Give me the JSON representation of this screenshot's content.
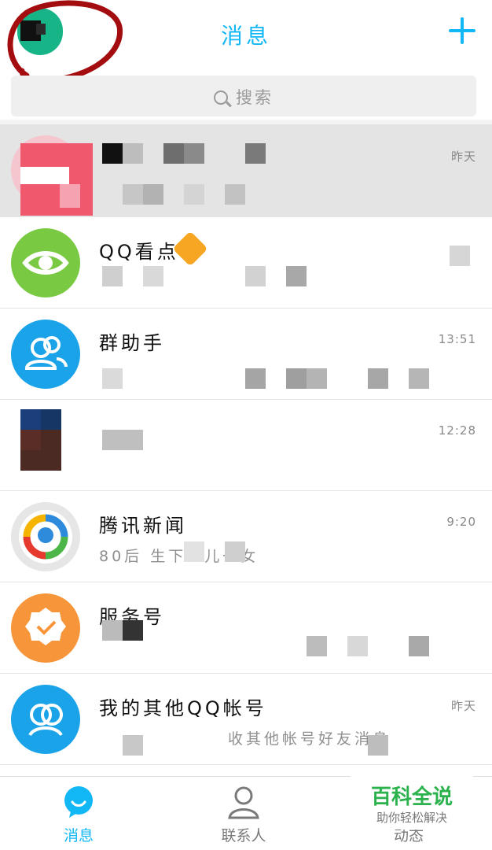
{
  "header": {
    "title": "消息",
    "plus_icon": "plus-icon",
    "accent": "#12b7f5"
  },
  "search": {
    "placeholder": "搜索",
    "icon": "search-icon"
  },
  "conversations": [
    {
      "name": "",
      "preview": "",
      "time": "昨天",
      "pinned": true
    },
    {
      "name": "QQ看点",
      "preview": "",
      "time": "",
      "icon": "eye-icon",
      "color": "#7ac943"
    },
    {
      "name": "群助手",
      "preview": "",
      "time": "13:51",
      "icon": "group-icon",
      "color": "#1aa3e8"
    },
    {
      "name": "",
      "preview": "",
      "time": "12:28"
    },
    {
      "name": "腾讯新闻",
      "preview": "80后  生下一儿一女",
      "time": "9:20",
      "icon": "tencent-news-icon"
    },
    {
      "name": "服务号",
      "preview": "",
      "time": "",
      "icon": "service-badge-icon",
      "color": "#f7953a"
    },
    {
      "name": "我的其他QQ帐号",
      "preview": "收其他帐号好友消息",
      "time": "昨天",
      "icon": "accounts-icon",
      "color": "#1aa3e8"
    }
  ],
  "tabbar": {
    "tabs": [
      {
        "label": "消息",
        "icon": "chat-bubble-icon",
        "active": true
      },
      {
        "label": "联系人",
        "icon": "contacts-icon",
        "active": false
      },
      {
        "label": "动态",
        "icon": "star-icon",
        "active": false
      }
    ]
  },
  "watermark": {
    "title": "百科全说",
    "subtitle": "助你轻松解决"
  }
}
